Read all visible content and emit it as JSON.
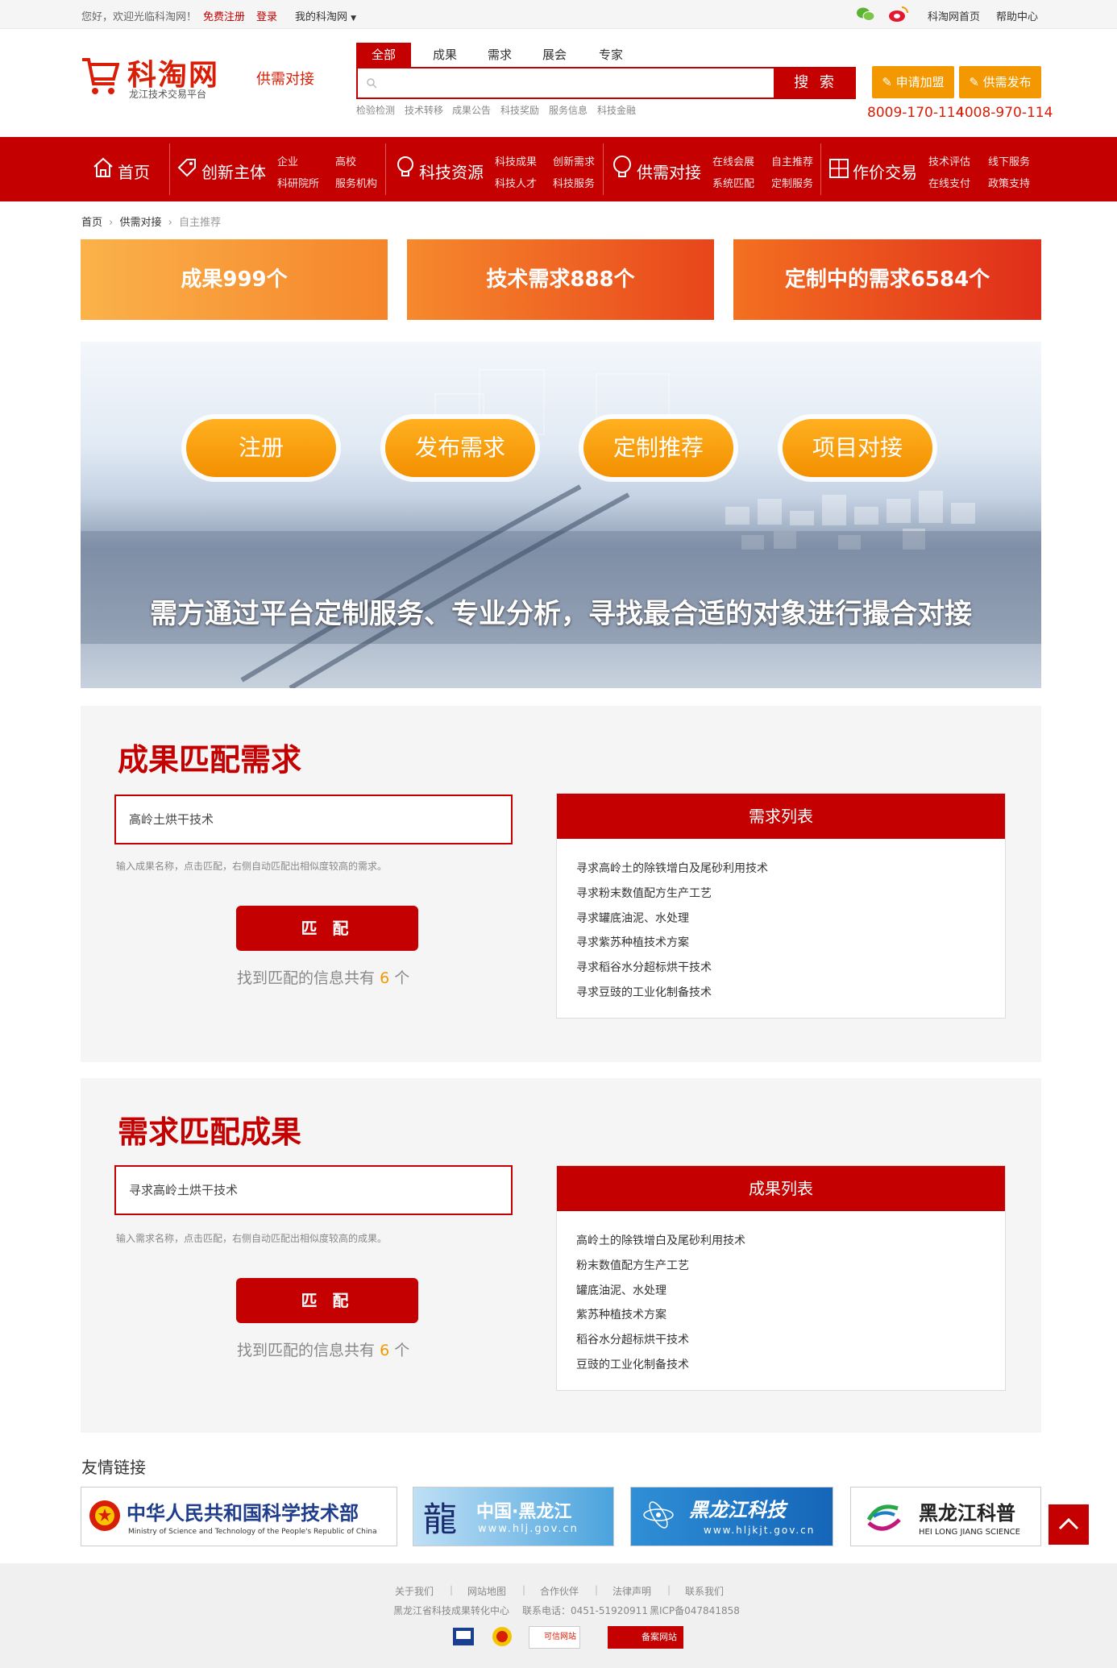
{
  "topbar": {
    "welcome": "您好，欢迎光临科淘网！",
    "register": "免费注册",
    "login": "登录",
    "my_account": "我的科淘网",
    "home": "科淘网首页",
    "help": "帮助中心"
  },
  "logo": {
    "name": "科淘网",
    "subtitle": "龙江技术交易平台",
    "tag": "供需对接"
  },
  "search": {
    "tabs": [
      "全部",
      "成果",
      "需求",
      "展会",
      "专家"
    ],
    "active_tab": "全部",
    "placeholder": "",
    "button": "搜 索",
    "hot_words": [
      "检验检测",
      "技术转移",
      "成果公告",
      "科技奖励",
      "服务信息",
      "科技金融"
    ]
  },
  "header_buttons": {
    "apply": "申请加盟",
    "publish": "供需发布"
  },
  "phones": [
    "8009-170-114",
    "4008-970-114"
  ],
  "nav": {
    "home": "首页",
    "groups": [
      {
        "title": "创新主体",
        "links": [
          "企业",
          "高校",
          "科研院所",
          "服务机构"
        ]
      },
      {
        "title": "科技资源",
        "links": [
          "科技成果",
          "创新需求",
          "科技人才",
          "科技服务"
        ]
      },
      {
        "title": "供需对接",
        "links": [
          "在线会展",
          "自主推荐",
          "系统匹配",
          "定制服务"
        ]
      },
      {
        "title": "作价交易",
        "links": [
          "技术评估",
          "线下服务",
          "在线支付",
          "政策支持"
        ]
      }
    ]
  },
  "breadcrumb": [
    "首页",
    "供需对接",
    "自主推荐"
  ],
  "stats": [
    "成果999个",
    "技术需求888个",
    "定制中的需求6584个"
  ],
  "hero": {
    "buttons": [
      "注册",
      "发布需求",
      "定制推荐",
      "项目对接"
    ],
    "slogan": "需方通过平台定制服务、专业分析，寻找最合适的对象进行撮合对接"
  },
  "match_result_to_demand": {
    "title": "成果匹配需求",
    "input_value": "高岭土烘干技术",
    "hint": "输入成果名称，点击匹配，右侧自动匹配出相似度较高的需求。",
    "button": "匹 配",
    "found_prefix": "找到匹配的信息共有",
    "found_count": "6",
    "found_suffix": "个",
    "list_title": "需求列表",
    "items": [
      "寻求高岭土的除铁增白及尾砂利用技术",
      "寻求粉末数值配方生产工艺",
      "寻求罐底油泥、水处理",
      "寻求紫苏种植技术方案",
      "寻求稻谷水分超标烘干技术",
      "寻求豆豉的工业化制备技术"
    ]
  },
  "match_demand_to_result": {
    "title": "需求匹配成果",
    "input_value": "寻求高岭土烘干技术",
    "hint": "输入需求名称，点击匹配，右侧自动匹配出相似度较高的成果。",
    "button": "匹 配",
    "found_prefix": "找到匹配的信息共有",
    "found_count": "6",
    "found_suffix": "个",
    "list_title": "成果列表",
    "items": [
      "高岭土的除铁增白及尾砂利用技术",
      "粉末数值配方生产工艺",
      "罐底油泥、水处理",
      "紫苏种植技术方案",
      "稻谷水分超标烘干技术",
      "豆豉的工业化制备技术"
    ]
  },
  "friend_links": {
    "title": "友情链接",
    "most": {
      "cn": "中华人民共和国科学技术部",
      "en": "Ministry of Science and Technology of the People's Republic of China"
    },
    "hlj_gov": {
      "cn": "中国·黑龙江",
      "url": "www.hlj.gov.cn"
    },
    "hlj_kj": {
      "cn": "黑龙江科技",
      "url": "www.hljkjt.gov.cn"
    },
    "hlj_kp": {
      "cn": "黑龙江科普",
      "en": "HEI LONG JIANG SCIENCE"
    }
  },
  "footer": {
    "links": [
      "关于我们",
      "网站地图",
      "合作伙伴",
      "法律声明",
      "联系我们"
    ],
    "org": "黑龙江省科技成果转化中心",
    "tel": "联系电话：0451-51920911",
    "icp": "黑ICP备047841858",
    "badges": [
      "可信网站",
      "备案网站"
    ]
  },
  "colors": {
    "brand_red": "#c40000",
    "orange": "#f39800"
  }
}
